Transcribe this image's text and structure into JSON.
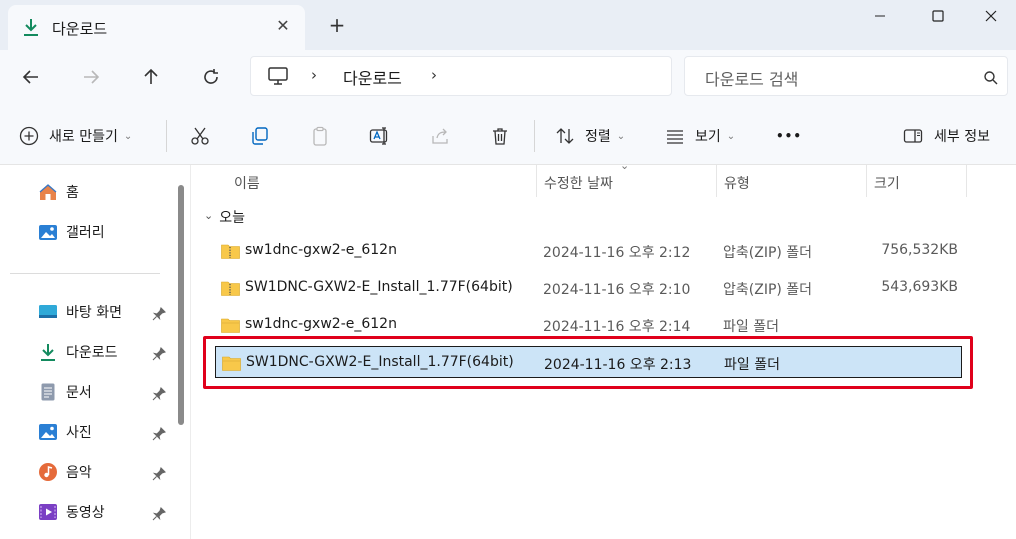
{
  "tab": {
    "title": "다운로드",
    "close": "✕",
    "new": "+"
  },
  "window": {
    "minimize": "—",
    "maximize": "☐",
    "close": "✕"
  },
  "address": {
    "crumb": "다운로드",
    "sep": "›",
    "search_placeholder": "다운로드 검색"
  },
  "toolbar": {
    "new_label": "새로 만들기",
    "sort_label": "정렬",
    "view_label": "보기",
    "more_label": "•••",
    "details_label": "세부 정보",
    "chevron": "⌄"
  },
  "sidebar": {
    "items": [
      {
        "label": "홈",
        "icon": "home-icon"
      },
      {
        "label": "갤러리",
        "icon": "gallery-icon"
      },
      {
        "label": "바탕 화면",
        "icon": "desktop-icon"
      },
      {
        "label": "다운로드",
        "icon": "download-icon"
      },
      {
        "label": "문서",
        "icon": "documents-icon"
      },
      {
        "label": "사진",
        "icon": "pictures-icon"
      },
      {
        "label": "음악",
        "icon": "music-icon"
      },
      {
        "label": "동영상",
        "icon": "videos-icon"
      }
    ]
  },
  "columns": {
    "name": "이름",
    "date": "수정한 날짜",
    "type": "유형",
    "size": "크기"
  },
  "group": {
    "label": "오늘",
    "chevron": "⌄"
  },
  "files": [
    {
      "name": "sw1dnc-gxw2-e_612n",
      "date": "2024-11-16 오후 2:12",
      "type": "압축(ZIP) 폴더",
      "size": "756,532KB",
      "kind": "zip"
    },
    {
      "name": "SW1DNC-GXW2-E_Install_1.77F(64bit)",
      "date": "2024-11-16 오후 2:10",
      "type": "압축(ZIP) 폴더",
      "size": "543,693KB",
      "kind": "zip"
    },
    {
      "name": "sw1dnc-gxw2-e_612n",
      "date": "2024-11-16 오후 2:14",
      "type": "파일 폴더",
      "size": "",
      "kind": "folder"
    },
    {
      "name": "SW1DNC-GXW2-E_Install_1.77F(64bit)",
      "date": "2024-11-16 오후 2:13",
      "type": "파일 폴더",
      "size": "",
      "kind": "folder",
      "selected": true
    }
  ],
  "colors": {
    "accent": "#0067c0",
    "selection": "#cce4f7",
    "highlight": "#e0001b",
    "folder": "#f8c84a"
  }
}
